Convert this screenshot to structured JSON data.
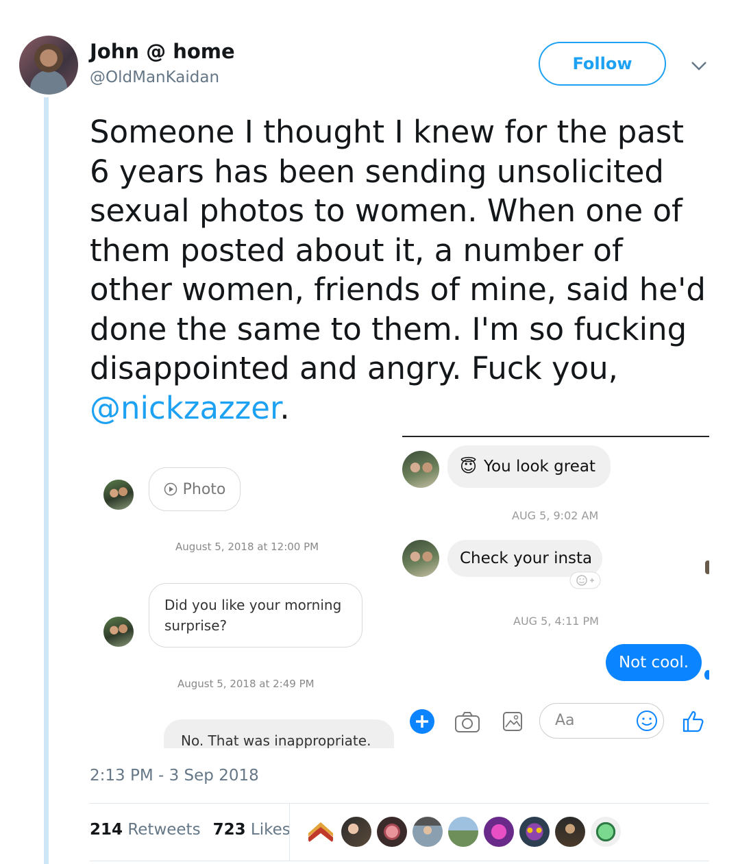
{
  "tweet": {
    "author_name": "John @ home",
    "author_handle": "@OldManKaidan",
    "follow_label": "Follow",
    "text_main": "Someone I thought I knew for the past 6 years has been sending unsolicited sexual photos to women. When one of them posted about it, a number of other women, friends of mine, said he'd done the same to them. I'm so fucking disappointed and angry. Fuck you, ",
    "mention": "@nickzazzer",
    "text_end": ".",
    "timestamp": "2:13 PM - 3 Sep 2018",
    "retweets_count": "214",
    "retweets_label": "Retweets",
    "likes_count": "723",
    "likes_label": "Likes"
  },
  "screenshot_left": {
    "photo_label": "Photo",
    "ts1": "August 5, 2018 at 12:00 PM",
    "message1": "Did you like your morning surprise?",
    "ts2": "August 5, 2018 at 2:49 PM",
    "message2": "No. That was inappropriate."
  },
  "screenshot_right": {
    "msg1_emoji": "😇",
    "msg1": "You look great",
    "ts1": "AUG 5, 9:02 AM",
    "msg2": "Check your insta",
    "ts2": "AUG 5, 4:11 PM",
    "reply": "Not cool.",
    "composer_placeholder": "Aa"
  },
  "colors": {
    "twitter_blue": "#1da1f2",
    "messenger_blue": "#0a84ff",
    "thread_line": "#cde7f8"
  },
  "liker_avatars": [
    "rank-insignia",
    "couple",
    "rose",
    "hat-person",
    "field",
    "pink-character",
    "masked-character",
    "person-dark",
    "green-character"
  ]
}
